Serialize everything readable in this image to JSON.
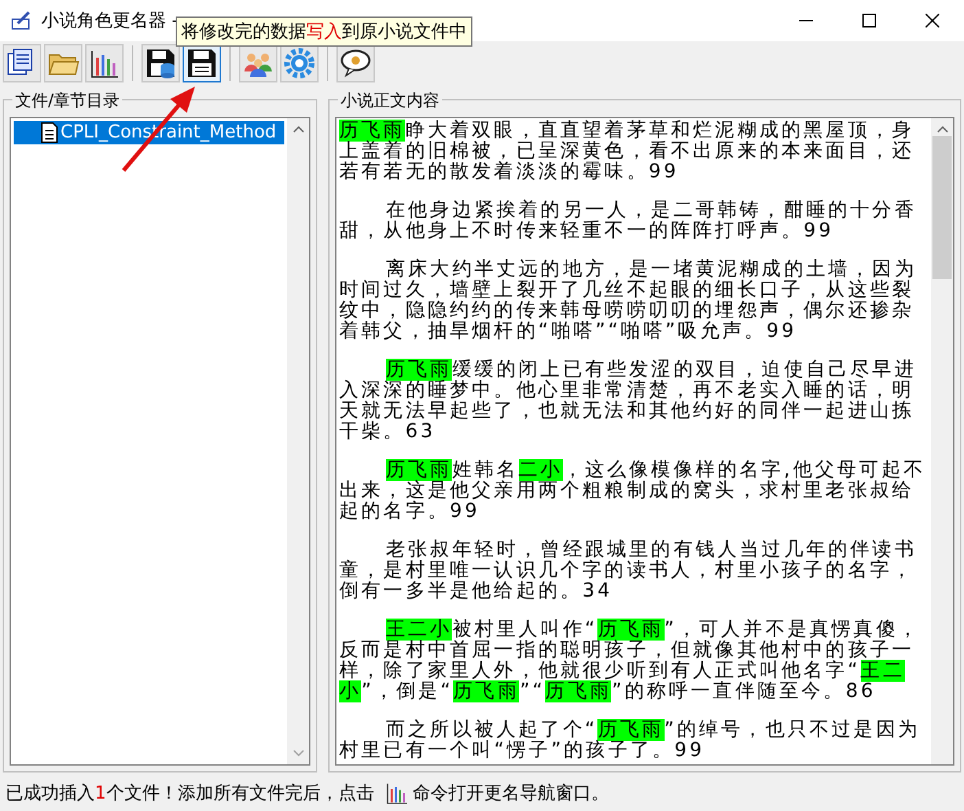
{
  "window": {
    "title": "小说角色更名器 -"
  },
  "toolbar": [
    {
      "kind": "pages",
      "selected": false
    },
    {
      "kind": "folder",
      "selected": false
    },
    {
      "kind": "chart",
      "selected": false
    },
    {
      "kind": "sep"
    },
    {
      "kind": "save-db",
      "selected": false
    },
    {
      "kind": "save",
      "selected": true
    },
    {
      "kind": "sep"
    },
    {
      "kind": "people",
      "selected": false
    },
    {
      "kind": "gear",
      "selected": false
    },
    {
      "kind": "sep"
    },
    {
      "kind": "speech",
      "selected": false
    }
  ],
  "tooltip": [
    {
      "text": "将修改完的数据",
      "highlight": false
    },
    {
      "text": "写入",
      "highlight": true
    },
    {
      "text": "到原小说文件中",
      "highlight": false
    }
  ],
  "tree": {
    "title": "文件/章节目录",
    "items": [
      {
        "label": "CPLI_Constraint_Method",
        "selected": true
      }
    ]
  },
  "content": {
    "title": "小说正文内容",
    "paragraphs": [
      {
        "indent": false,
        "parts": [
          {
            "text": "历飞雨",
            "highlight": true
          },
          {
            "text": "睁大着双眼，直直望着茅草和烂泥糊成的黑屋顶，身上盖着的旧棉被，已呈深黄色，看不出原来的本来面目，还若有若无的散发着淡淡的霉味。99",
            "highlight": false
          }
        ]
      },
      {
        "indent": true,
        "parts": [
          {
            "text": "在他身边紧挨着的另一人，是二哥韩铸，酣睡的十分香甜，从他身上不时传来轻重不一的阵阵打呼声。99",
            "highlight": false
          }
        ]
      },
      {
        "indent": true,
        "parts": [
          {
            "text": "离床大约半丈远的地方，是一堵黄泥糊成的土墙，因为时间过久，墙壁上裂开了几丝不起眼的细长口子，从这些裂纹中，隐隐约约的传来韩母唠唠叨叨的埋怨声，偶尔还掺杂着韩父，抽旱烟杆的“啪嗒”“啪嗒”吸允声。99",
            "highlight": false
          }
        ]
      },
      {
        "indent": true,
        "parts": [
          {
            "text": "历飞雨",
            "highlight": true
          },
          {
            "text": "缓缓的闭上已有些发涩的双目，迫使自己尽早进入深深的睡梦中。他心里非常清楚，再不老实入睡的话，明天就无法早起些了，也就无法和其他约好的同伴一起进山拣干柴。63",
            "highlight": false
          }
        ]
      },
      {
        "indent": true,
        "parts": [
          {
            "text": "历飞雨",
            "highlight": true
          },
          {
            "text": "姓韩名",
            "highlight": false
          },
          {
            "text": "二小",
            "highlight": true
          },
          {
            "text": "，这么像模像样的名字,他父母可起不出来，这是他父亲用两个粗粮制成的窝头，求村里老张叔给起的名字。99",
            "highlight": false
          }
        ]
      },
      {
        "indent": true,
        "parts": [
          {
            "text": "老张叔年轻时，曾经跟城里的有钱人当过几年的伴读书童，是村里唯一认识几个字的读书人，村里小孩子的名字，倒有一多半是他给起的。34",
            "highlight": false
          }
        ]
      },
      {
        "indent": true,
        "parts": [
          {
            "text": "王二小",
            "highlight": true
          },
          {
            "text": "被村里人叫作“",
            "highlight": false
          },
          {
            "text": "历飞雨",
            "highlight": true
          },
          {
            "text": "”，可人并不是真愣真傻，反而是村中首屈一指的聪明孩子，但就像其他村中的孩子一样，除了家里人外，他就很少听到有人正式叫他名字“",
            "highlight": false
          },
          {
            "text": "王二小",
            "highlight": true
          },
          {
            "text": "”，倒是“",
            "highlight": false
          },
          {
            "text": "历飞雨",
            "highlight": true
          },
          {
            "text": "”“",
            "highlight": false
          },
          {
            "text": "历飞雨",
            "highlight": true
          },
          {
            "text": "”的称呼一直伴随至今。86",
            "highlight": false
          }
        ]
      },
      {
        "indent": true,
        "parts": [
          {
            "text": "而之所以被人起了个“",
            "highlight": false
          },
          {
            "text": "历飞雨",
            "highlight": true
          },
          {
            "text": "”的绰号，也只不过是因为村里已有一个叫“愣子”的孩子了。99",
            "highlight": false
          }
        ]
      }
    ]
  },
  "status": [
    {
      "kind": "text",
      "text": "已成功插入"
    },
    {
      "kind": "count",
      "text": "1"
    },
    {
      "kind": "text",
      "text": "个文件！添加所有文件完后，点击"
    },
    {
      "kind": "icon"
    },
    {
      "kind": "text",
      "text": "命令打开更名导航窗口。"
    }
  ]
}
